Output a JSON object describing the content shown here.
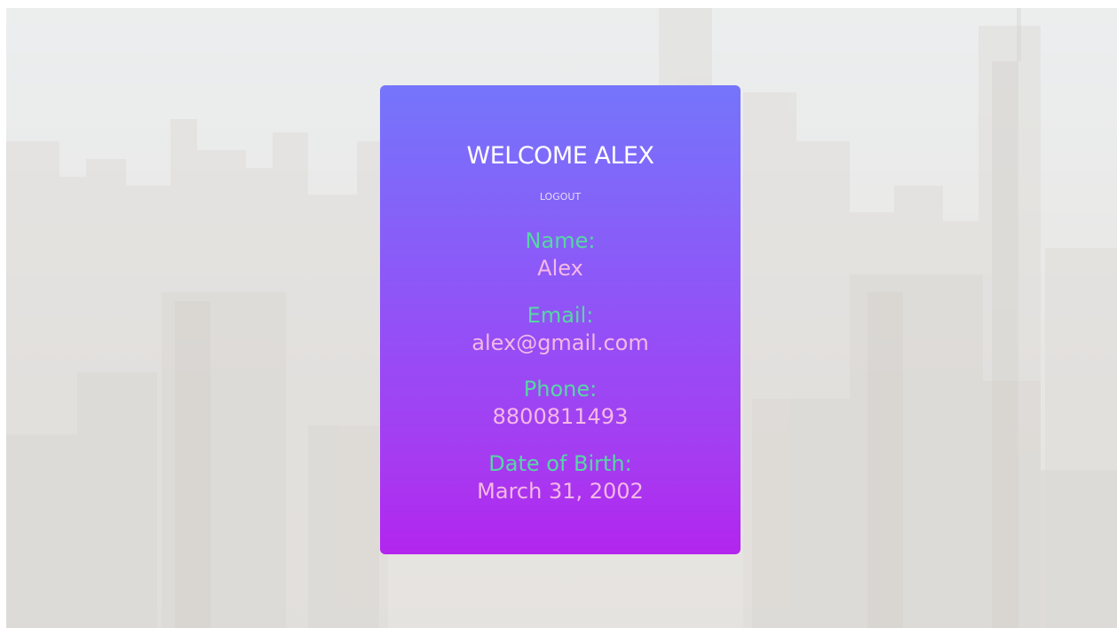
{
  "profile": {
    "welcome": "WELCOME ALEX",
    "logout_label": "LOGOUT",
    "fields": [
      {
        "label": "Name:",
        "value": "Alex"
      },
      {
        "label": "Email:",
        "value": "alex@gmail.com"
      },
      {
        "label": "Phone:",
        "value": "8800811493"
      },
      {
        "label": "Date of Birth:",
        "value": "March 31, 2002"
      }
    ]
  },
  "colors": {
    "card_top": "#7575fb",
    "card_bottom": "#b225ee",
    "label": "#56d7a4",
    "value": "#f4b8e6",
    "heading": "#ffffff"
  }
}
